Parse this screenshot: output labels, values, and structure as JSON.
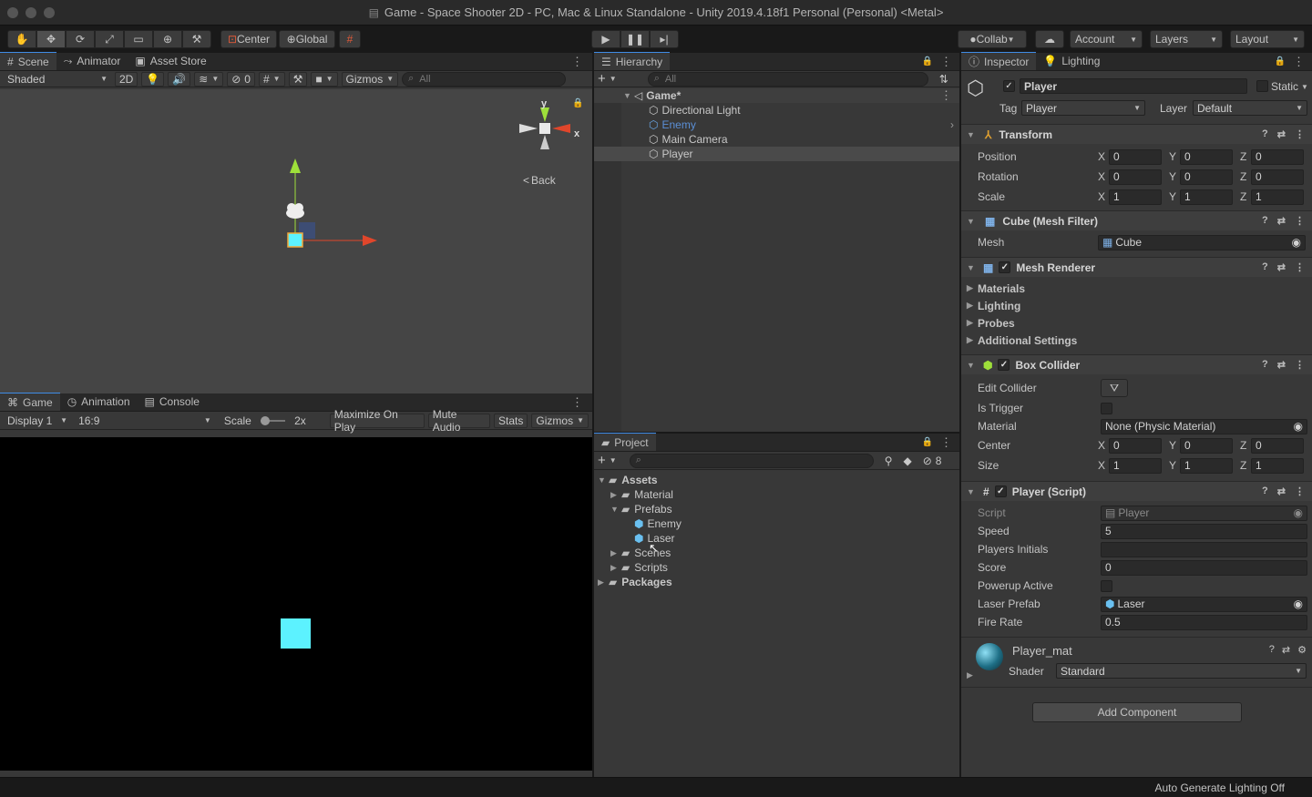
{
  "window": {
    "title": "Game - Space Shooter 2D - PC, Mac & Linux Standalone - Unity 2019.4.18f1 Personal (Personal) <Metal>"
  },
  "toolbar": {
    "pivot_label": "Center",
    "space_label": "Global",
    "collab_label": "Collab",
    "account_label": "Account",
    "layers_label": "Layers",
    "layout_label": "Layout"
  },
  "scene": {
    "tabs": [
      "Scene",
      "Animator",
      "Asset Store"
    ],
    "shading": "Shaded",
    "mode_2d": "2D",
    "hidden_count": "0",
    "gizmos_label": "Gizmos",
    "search_placeholder": "All",
    "back_label": "Back",
    "axis_x": "x",
    "axis_y": "y"
  },
  "game": {
    "tabs": [
      "Game",
      "Animation",
      "Console"
    ],
    "display": "Display 1",
    "aspect": "16:9",
    "scale_label": "Scale",
    "scale_value": "2x",
    "maximize": "Maximize On Play",
    "mute": "Mute Audio",
    "stats": "Stats",
    "gizmos": "Gizmos"
  },
  "hierarchy": {
    "tab": "Hierarchy",
    "search_placeholder": "All",
    "scene_name": "Game*",
    "items": [
      "Directional Light",
      "Enemy",
      "Main Camera",
      "Player"
    ]
  },
  "project": {
    "tab": "Project",
    "hidden_count": "8",
    "assets_label": "Assets",
    "folders": [
      "Material",
      "Prefabs",
      "Scenes",
      "Scripts"
    ],
    "prefabs": [
      "Enemy",
      "Laser"
    ],
    "packages_label": "Packages"
  },
  "inspector": {
    "tabs": [
      "Inspector",
      "Lighting"
    ],
    "object_name": "Player",
    "static_label": "Static",
    "tag_label": "Tag",
    "tag_value": "Player",
    "layer_label": "Layer",
    "layer_value": "Default",
    "transform": {
      "title": "Transform",
      "position_label": "Position",
      "position": [
        "0",
        "0",
        "0"
      ],
      "rotation_label": "Rotation",
      "rotation": [
        "0",
        "0",
        "0"
      ],
      "scale_label": "Scale",
      "scale": [
        "1",
        "1",
        "1"
      ]
    },
    "mesh_filter": {
      "title": "Cube (Mesh Filter)",
      "mesh_label": "Mesh",
      "mesh_value": "Cube"
    },
    "mesh_renderer": {
      "title": "Mesh Renderer",
      "sections": [
        "Materials",
        "Lighting",
        "Probes",
        "Additional Settings"
      ]
    },
    "box_collider": {
      "title": "Box Collider",
      "edit_label": "Edit Collider",
      "trigger_label": "Is Trigger",
      "material_label": "Material",
      "material_value": "None (Physic Material)",
      "center_label": "Center",
      "center": [
        "0",
        "0",
        "0"
      ],
      "size_label": "Size",
      "size": [
        "1",
        "1",
        "1"
      ]
    },
    "player_script": {
      "title": "Player (Script)",
      "script_label": "Script",
      "script_value": "Player",
      "speed_label": "Speed",
      "speed_value": "5",
      "initials_label": "Players Initials",
      "initials_value": "",
      "score_label": "Score",
      "score_value": "0",
      "powerup_label": "Powerup Active",
      "laser_label": "Laser Prefab",
      "laser_value": "Laser",
      "fire_label": "Fire Rate",
      "fire_value": "0.5"
    },
    "material": {
      "name": "Player_mat",
      "shader_label": "Shader",
      "shader_value": "Standard"
    },
    "add_component": "Add Component"
  },
  "status": {
    "text": "Auto Generate Lighting Off"
  },
  "colors": {
    "accent": "#3f8ce6",
    "game_bg": "#000000",
    "player_cube": "#5cf2ff",
    "scene_bg": "#454545"
  }
}
